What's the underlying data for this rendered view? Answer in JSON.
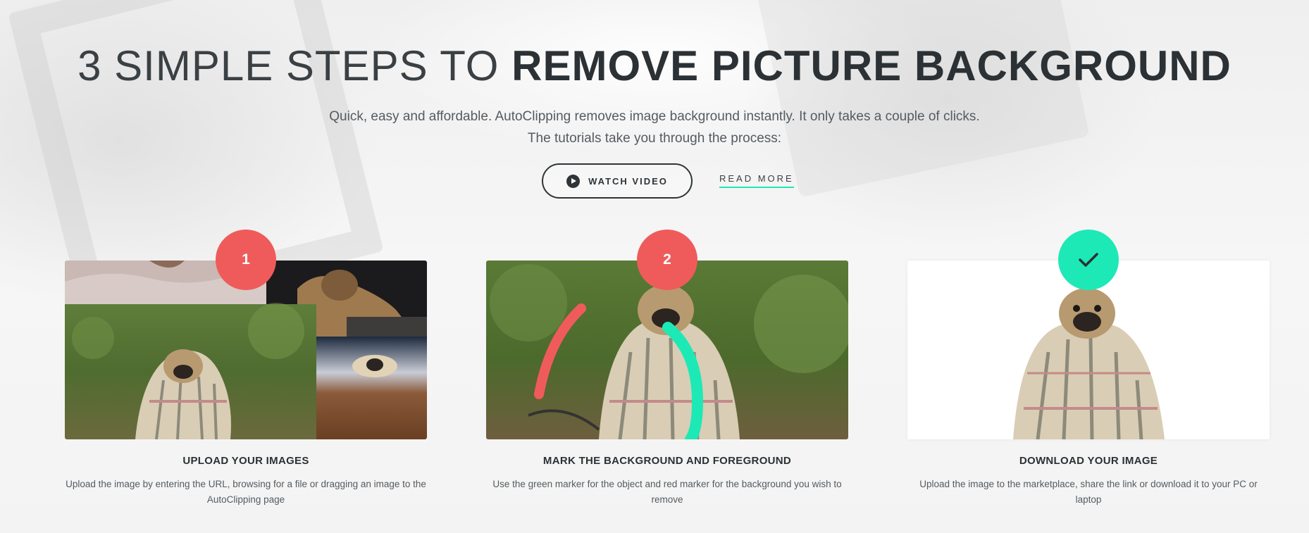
{
  "hero": {
    "title_light": "3 SIMPLE STEPS TO ",
    "title_bold": "REMOVE PICTURE BACKGROUND",
    "subtitle_line1": "Quick, easy and affordable. AutoClipping removes image background instantly. It only takes a couple of clicks.",
    "subtitle_line2": "The tutorials take you through the process:",
    "watch_video_label": "WATCH VIDEO",
    "read_more_label": "READ MORE"
  },
  "steps": [
    {
      "badge": "1",
      "title": "UPLOAD YOUR IMAGES",
      "description": "Upload the image by entering the URL, browsing for a file or dragging an image to the AutoClipping page"
    },
    {
      "badge": "2",
      "title": "MARK THE BACKGROUND AND FOREGROUND",
      "description": "Use the green marker for the object and red marker for the background you wish to remove"
    },
    {
      "badge": "check-icon",
      "title": "DOWNLOAD YOUR IMAGE",
      "description": "Upload the image to the marketplace, share the link or download it to your PC or laptop"
    }
  ],
  "colors": {
    "accent_red": "#ef5b5b",
    "accent_green": "#1de9b6",
    "text_dark": "#2b3134"
  }
}
